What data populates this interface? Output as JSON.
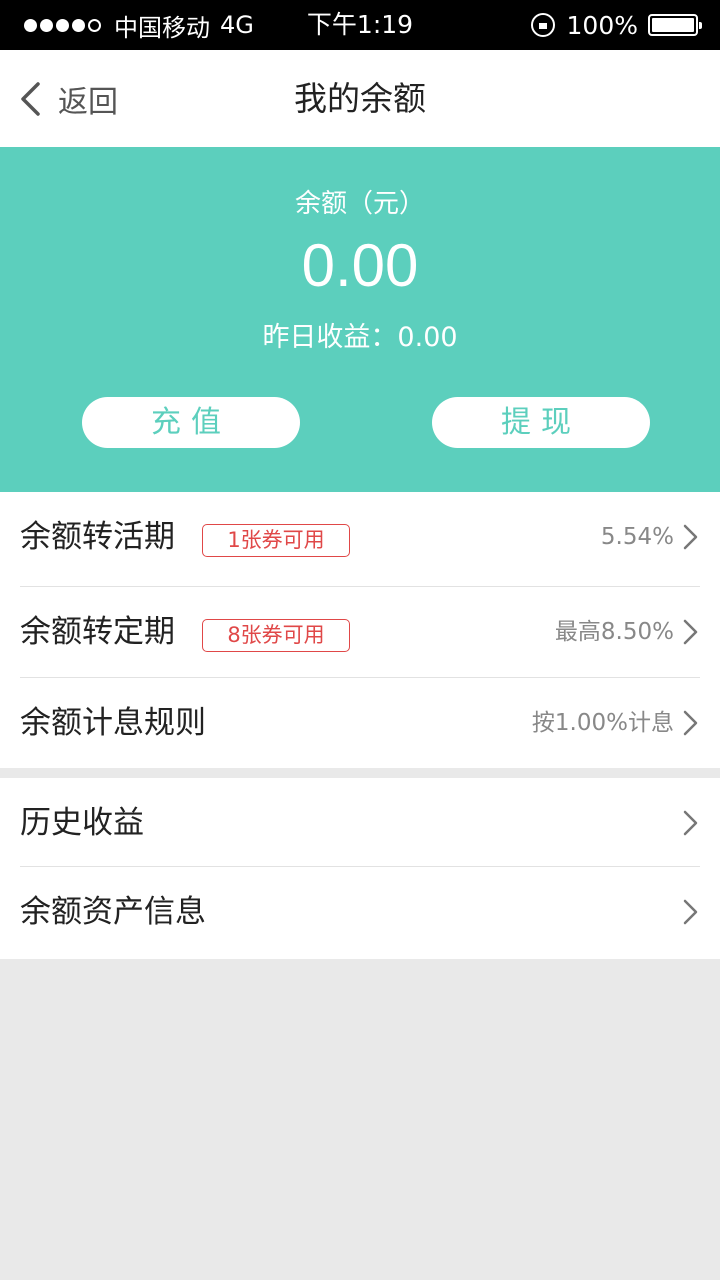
{
  "status_bar": {
    "carrier": "中国移动",
    "network": "4G",
    "time": "下午1:19",
    "battery": "100%"
  },
  "nav": {
    "back_label": "返回",
    "title": "我的余额"
  },
  "hero": {
    "label": "余额（元）",
    "amount": "0.00",
    "yesterday": "昨日收益：0.00",
    "recharge_label": "充值",
    "withdraw_label": "提现",
    "accent_color": "#5ccfbd"
  },
  "list1": {
    "items": [
      {
        "title": "余额转活期",
        "coupon": "1张券可用",
        "value": "5.54%"
      },
      {
        "title": "余额转定期",
        "coupon": "8张券可用",
        "value": "最高8.50%"
      },
      {
        "title": "余额计息规则",
        "value": "按1.00%计息"
      }
    ]
  },
  "list2": {
    "items": [
      {
        "title": "历史收益"
      },
      {
        "title": "余额资产信息"
      }
    ]
  }
}
